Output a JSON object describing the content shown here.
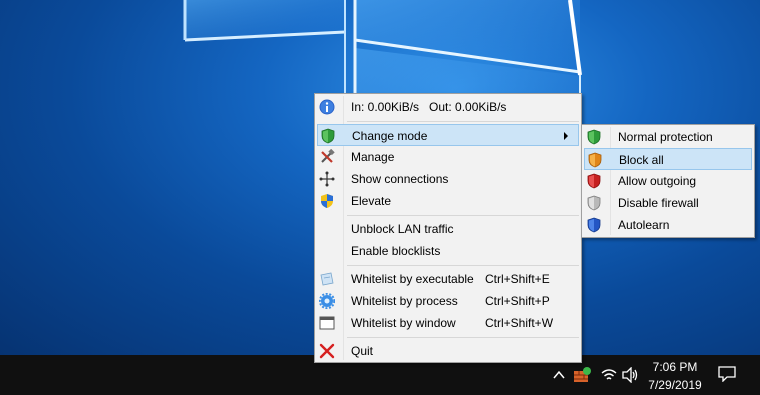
{
  "menu": {
    "stats": {
      "text": "In: 0.00KiB/s   Out: 0.00KiB/s",
      "icon": "info-icon"
    },
    "items": [
      {
        "label": "Change mode",
        "icon": "shield-green-icon",
        "has_submenu": true
      },
      {
        "label": "Manage",
        "icon": "tools-icon"
      },
      {
        "label": "Show connections",
        "icon": "network-icon"
      },
      {
        "label": "Elevate",
        "icon": "uac-shield-icon"
      },
      {
        "label": "Unblock LAN traffic"
      },
      {
        "label": "Enable blocklists"
      },
      {
        "label": "Whitelist by executable",
        "shortcut": "Ctrl+Shift+E",
        "icon": "file-icon"
      },
      {
        "label": "Whitelist by process",
        "shortcut": "Ctrl+Shift+P",
        "icon": "gear-icon"
      },
      {
        "label": "Whitelist by window",
        "shortcut": "Ctrl+Shift+W",
        "icon": "window-icon"
      },
      {
        "label": "Quit",
        "icon": "close-icon"
      }
    ]
  },
  "submenu": {
    "items": [
      {
        "label": "Normal protection",
        "icon": "shield-green-icon"
      },
      {
        "label": "Block all",
        "icon": "shield-orange-icon",
        "selected": true
      },
      {
        "label": "Allow outgoing",
        "icon": "shield-red-icon"
      },
      {
        "label": "Disable firewall",
        "icon": "shield-gray-icon"
      },
      {
        "label": "Autolearn",
        "icon": "shield-blue-icon"
      }
    ]
  },
  "taskbar": {
    "time": "7:06 PM",
    "date": "7/29/2019"
  },
  "colors": {
    "highlight": "#cce4f7",
    "menu_bg": "#f2f2f2",
    "taskbar": "#101010",
    "desktop": "#0a4a9a"
  }
}
